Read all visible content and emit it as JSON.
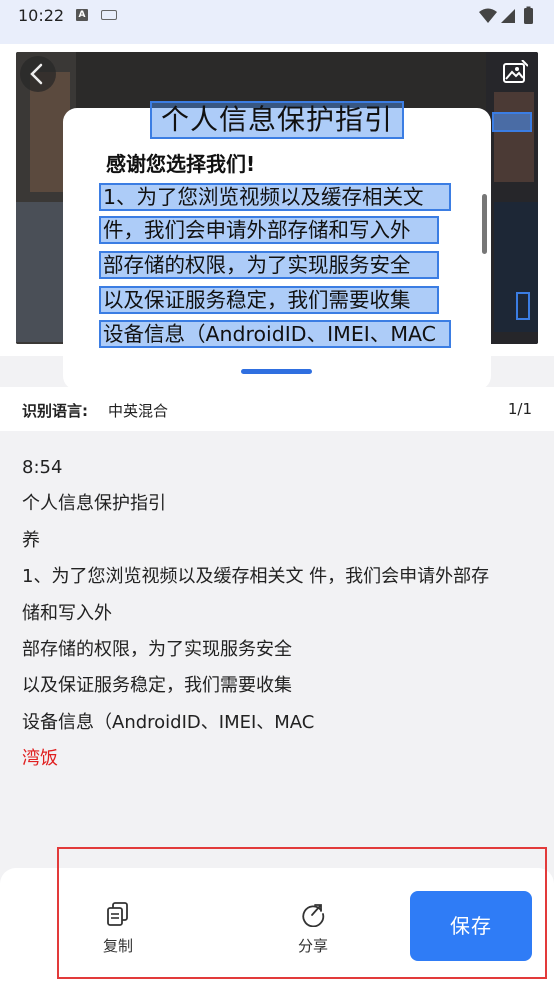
{
  "status_bar": {
    "time": "10:22",
    "a_badge": "A"
  },
  "icons": {
    "back": "back-arrow-icon",
    "image_edit": "image-edit-icon",
    "copy": "copy-icon",
    "share": "share-icon",
    "wifi": "wifi-icon",
    "signal": "signal-icon",
    "battery": "battery-icon",
    "keyboard": "keyboard-icon"
  },
  "preview": {
    "dialog_title": "个人信息保护指引",
    "dialog_thanks": "感谢您选择我们!",
    "ocr_lines": [
      "1、为了您浏览视频以及缓存相关文",
      "件，我们会申请外部存储和写入外",
      "部存储的权限，为了实现服务安全",
      "以及保证服务稳定，我们需要收集",
      "设备信息（AndroidID、IMEI、MAC"
    ]
  },
  "recognition": {
    "label": "识别语言:",
    "language": "中英混合",
    "page": "1/1"
  },
  "result_lines": [
    "8:54",
    "个人信息保护指引",
    "养",
    "1、为了您浏览视频以及缓存相关文 件，我们会申请外部存",
    "储和写入外",
    "部存储的权限，为了实现服务安全",
    "以及保证服务稳定，我们需要收集",
    "设备信息（AndroidID、IMEI、MAC"
  ],
  "result_error_line": "湾饭",
  "actions": {
    "copy_label": "复制",
    "share_label": "分享",
    "save_label": "保存"
  },
  "colors": {
    "accent": "#2f7cf6",
    "ocr_highlight": "#4a8df0",
    "error_text": "#e02020",
    "annotation_box": "#e23a3a"
  }
}
